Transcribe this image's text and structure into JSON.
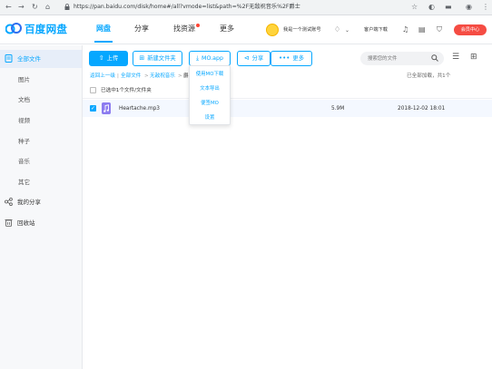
{
  "browser": {
    "url": "https://pan.baidu.com/disk/home#/all?vmode=list&path=%2F无敌祝音乐%2F爵士"
  },
  "header": {
    "logo_text": "百度网盘",
    "nav": [
      "网盘",
      "分享",
      "找资源",
      "更多"
    ],
    "username": "我是一个测试账号",
    "client_download": "客户端下载",
    "member_button": "会员中心",
    "colors": {
      "brand": "#06a7ff",
      "member": "#f54c43",
      "dot": "#ff4433"
    }
  },
  "sidebar": {
    "items": [
      {
        "label": "全部文件",
        "icon": "file-icon"
      },
      {
        "label": "图片"
      },
      {
        "label": "文档"
      },
      {
        "label": "视频"
      },
      {
        "label": "种子"
      },
      {
        "label": "音乐"
      },
      {
        "label": "其它"
      },
      {
        "label": "我的分享",
        "icon": "share-icon"
      },
      {
        "label": "回收站",
        "icon": "trash-icon"
      }
    ]
  },
  "toolbar": {
    "upload": "上传",
    "new_folder": "新建文件夹",
    "mo_app": "MO.app",
    "share": "分享",
    "more": "更多",
    "search_placeholder": "搜索您的文件"
  },
  "breadcrumb": {
    "back": "返回上一级",
    "sep": "|",
    "root": "全部文件",
    "arrow": ">",
    "folder": "无敌祝音乐",
    "current": "爵"
  },
  "status": {
    "loaded": "已全部加载，共1个",
    "selected": "已选中1个文件/文件夹"
  },
  "files": [
    {
      "name": "Heartache.mp3",
      "size": "5.9M",
      "date": "2018-12-02 18:01",
      "selected": true
    }
  ],
  "dropdown": {
    "items": [
      "使用MO下载",
      "文本导出",
      "便签MO",
      "设置"
    ]
  }
}
